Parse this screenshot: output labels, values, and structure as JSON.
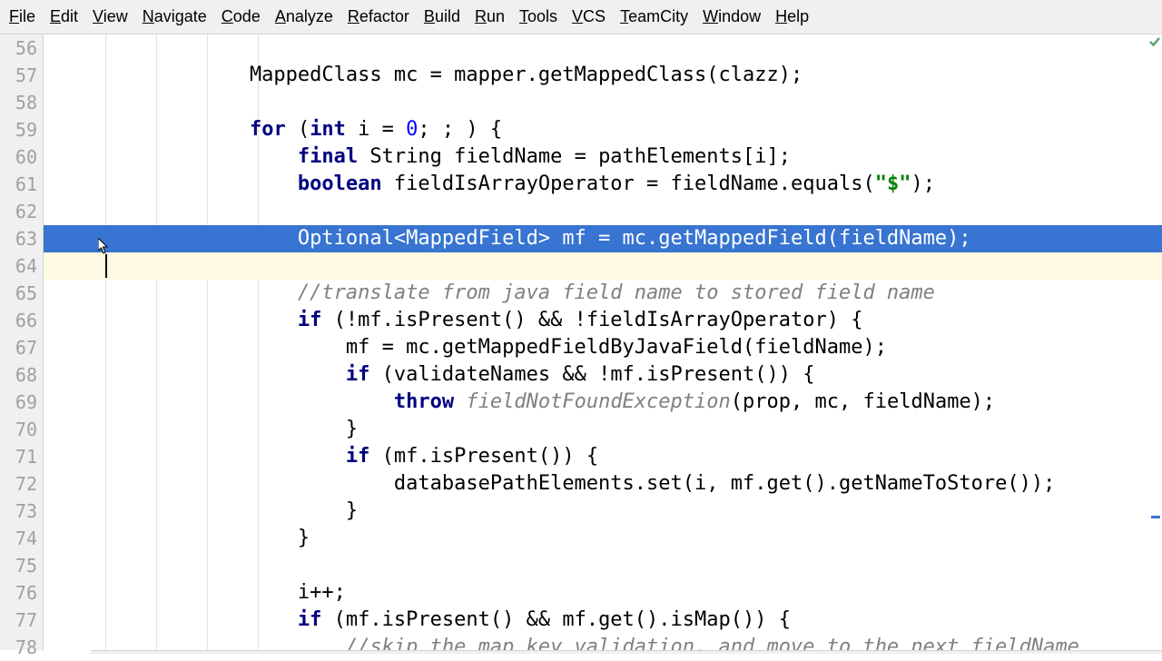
{
  "menu": {
    "items": [
      "File",
      "Edit",
      "View",
      "Navigate",
      "Code",
      "Analyze",
      "Refactor",
      "Build",
      "Run",
      "Tools",
      "VCS",
      "TeamCity",
      "Window",
      "Help"
    ]
  },
  "editor": {
    "first_line": 56,
    "selected_line": 63,
    "caret_line": 64,
    "lines": [
      {
        "n": 56,
        "segments": [
          {
            "t": "plain",
            "v": ""
          }
        ]
      },
      {
        "n": 57,
        "segments": [
          {
            "t": "plain",
            "v": "            MappedClass mc = mapper.getMappedClass(clazz);"
          }
        ]
      },
      {
        "n": 58,
        "segments": [
          {
            "t": "plain",
            "v": ""
          }
        ]
      },
      {
        "n": 59,
        "segments": [
          {
            "t": "plain",
            "v": "            "
          },
          {
            "t": "kw",
            "v": "for "
          },
          {
            "t": "plain",
            "v": "("
          },
          {
            "t": "kw",
            "v": "int "
          },
          {
            "t": "plain",
            "v": "i = "
          },
          {
            "t": "num",
            "v": "0"
          },
          {
            "t": "plain",
            "v": "; ; ) {"
          }
        ]
      },
      {
        "n": 60,
        "segments": [
          {
            "t": "plain",
            "v": "                "
          },
          {
            "t": "kw",
            "v": "final "
          },
          {
            "t": "plain",
            "v": "String fieldName = pathElements[i];"
          }
        ]
      },
      {
        "n": 61,
        "segments": [
          {
            "t": "plain",
            "v": "                "
          },
          {
            "t": "kw",
            "v": "boolean "
          },
          {
            "t": "plain",
            "v": "fieldIsArrayOperator = fieldName.equals("
          },
          {
            "t": "str",
            "v": "\"$\""
          },
          {
            "t": "plain",
            "v": ");"
          }
        ]
      },
      {
        "n": 62,
        "segments": [
          {
            "t": "plain",
            "v": ""
          }
        ]
      },
      {
        "n": 63,
        "segments": [
          {
            "t": "plain",
            "v": "                Optional<MappedField> mf = mc.getMappedField(fieldName);"
          }
        ]
      },
      {
        "n": 64,
        "segments": [
          {
            "t": "plain",
            "v": ""
          }
        ]
      },
      {
        "n": 65,
        "segments": [
          {
            "t": "plain",
            "v": "                "
          },
          {
            "t": "cm",
            "v": "//translate from java field name to stored field name"
          }
        ]
      },
      {
        "n": 66,
        "segments": [
          {
            "t": "plain",
            "v": "                "
          },
          {
            "t": "kw",
            "v": "if "
          },
          {
            "t": "plain",
            "v": "(!mf.isPresent() && !fieldIsArrayOperator) {"
          }
        ]
      },
      {
        "n": 67,
        "segments": [
          {
            "t": "plain",
            "v": "                    mf = mc.getMappedFieldByJavaField(fieldName);"
          }
        ]
      },
      {
        "n": 68,
        "segments": [
          {
            "t": "plain",
            "v": "                    "
          },
          {
            "t": "kw",
            "v": "if "
          },
          {
            "t": "plain",
            "v": "(validateNames && !mf.isPresent()) {"
          }
        ]
      },
      {
        "n": 69,
        "segments": [
          {
            "t": "plain",
            "v": "                        "
          },
          {
            "t": "kw",
            "v": "throw "
          },
          {
            "t": "cm",
            "v": "fieldNotFoundException"
          },
          {
            "t": "plain",
            "v": "(prop, mc, fieldName);"
          }
        ]
      },
      {
        "n": 70,
        "segments": [
          {
            "t": "plain",
            "v": "                    }"
          }
        ]
      },
      {
        "n": 71,
        "segments": [
          {
            "t": "plain",
            "v": "                    "
          },
          {
            "t": "kw",
            "v": "if "
          },
          {
            "t": "plain",
            "v": "(mf.isPresent()) {"
          }
        ]
      },
      {
        "n": 72,
        "segments": [
          {
            "t": "plain",
            "v": "                        databasePathElements.set(i, mf.get().getNameToStore());"
          }
        ]
      },
      {
        "n": 73,
        "segments": [
          {
            "t": "plain",
            "v": "                    }"
          }
        ]
      },
      {
        "n": 74,
        "segments": [
          {
            "t": "plain",
            "v": "                }"
          }
        ]
      },
      {
        "n": 75,
        "segments": [
          {
            "t": "plain",
            "v": ""
          }
        ]
      },
      {
        "n": 76,
        "segments": [
          {
            "t": "plain",
            "v": "                i++;"
          }
        ]
      },
      {
        "n": 77,
        "segments": [
          {
            "t": "plain",
            "v": "                "
          },
          {
            "t": "kw",
            "v": "if "
          },
          {
            "t": "plain",
            "v": "(mf.isPresent() && mf.get().isMap()) {"
          }
        ]
      },
      {
        "n": 78,
        "segments": [
          {
            "t": "plain",
            "v": "                    "
          },
          {
            "t": "cm",
            "v": "//skip the map key validation, and move to the next fieldName"
          }
        ]
      }
    ]
  }
}
